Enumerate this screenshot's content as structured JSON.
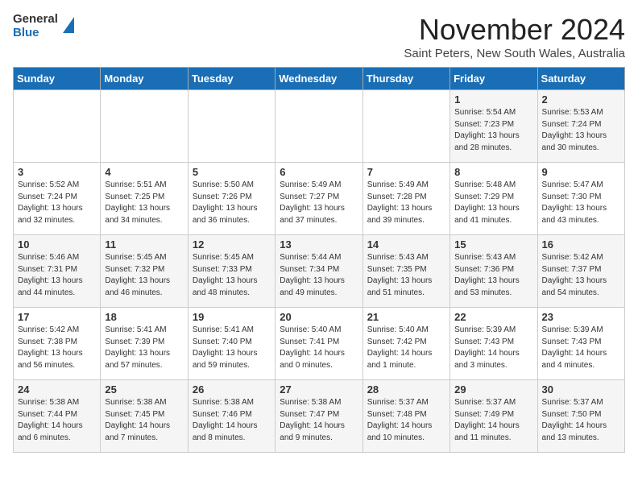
{
  "header": {
    "logo": {
      "general": "General",
      "blue": "Blue"
    },
    "title": "November 2024",
    "location": "Saint Peters, New South Wales, Australia"
  },
  "weekdays": [
    "Sunday",
    "Monday",
    "Tuesday",
    "Wednesday",
    "Thursday",
    "Friday",
    "Saturday"
  ],
  "weeks": [
    [
      {
        "day": "",
        "info": ""
      },
      {
        "day": "",
        "info": ""
      },
      {
        "day": "",
        "info": ""
      },
      {
        "day": "",
        "info": ""
      },
      {
        "day": "",
        "info": ""
      },
      {
        "day": "1",
        "info": "Sunrise: 5:54 AM\nSunset: 7:23 PM\nDaylight: 13 hours and 28 minutes."
      },
      {
        "day": "2",
        "info": "Sunrise: 5:53 AM\nSunset: 7:24 PM\nDaylight: 13 hours and 30 minutes."
      }
    ],
    [
      {
        "day": "3",
        "info": "Sunrise: 5:52 AM\nSunset: 7:24 PM\nDaylight: 13 hours and 32 minutes."
      },
      {
        "day": "4",
        "info": "Sunrise: 5:51 AM\nSunset: 7:25 PM\nDaylight: 13 hours and 34 minutes."
      },
      {
        "day": "5",
        "info": "Sunrise: 5:50 AM\nSunset: 7:26 PM\nDaylight: 13 hours and 36 minutes."
      },
      {
        "day": "6",
        "info": "Sunrise: 5:49 AM\nSunset: 7:27 PM\nDaylight: 13 hours and 37 minutes."
      },
      {
        "day": "7",
        "info": "Sunrise: 5:49 AM\nSunset: 7:28 PM\nDaylight: 13 hours and 39 minutes."
      },
      {
        "day": "8",
        "info": "Sunrise: 5:48 AM\nSunset: 7:29 PM\nDaylight: 13 hours and 41 minutes."
      },
      {
        "day": "9",
        "info": "Sunrise: 5:47 AM\nSunset: 7:30 PM\nDaylight: 13 hours and 43 minutes."
      }
    ],
    [
      {
        "day": "10",
        "info": "Sunrise: 5:46 AM\nSunset: 7:31 PM\nDaylight: 13 hours and 44 minutes."
      },
      {
        "day": "11",
        "info": "Sunrise: 5:45 AM\nSunset: 7:32 PM\nDaylight: 13 hours and 46 minutes."
      },
      {
        "day": "12",
        "info": "Sunrise: 5:45 AM\nSunset: 7:33 PM\nDaylight: 13 hours and 48 minutes."
      },
      {
        "day": "13",
        "info": "Sunrise: 5:44 AM\nSunset: 7:34 PM\nDaylight: 13 hours and 49 minutes."
      },
      {
        "day": "14",
        "info": "Sunrise: 5:43 AM\nSunset: 7:35 PM\nDaylight: 13 hours and 51 minutes."
      },
      {
        "day": "15",
        "info": "Sunrise: 5:43 AM\nSunset: 7:36 PM\nDaylight: 13 hours and 53 minutes."
      },
      {
        "day": "16",
        "info": "Sunrise: 5:42 AM\nSunset: 7:37 PM\nDaylight: 13 hours and 54 minutes."
      }
    ],
    [
      {
        "day": "17",
        "info": "Sunrise: 5:42 AM\nSunset: 7:38 PM\nDaylight: 13 hours and 56 minutes."
      },
      {
        "day": "18",
        "info": "Sunrise: 5:41 AM\nSunset: 7:39 PM\nDaylight: 13 hours and 57 minutes."
      },
      {
        "day": "19",
        "info": "Sunrise: 5:41 AM\nSunset: 7:40 PM\nDaylight: 13 hours and 59 minutes."
      },
      {
        "day": "20",
        "info": "Sunrise: 5:40 AM\nSunset: 7:41 PM\nDaylight: 14 hours and 0 minutes."
      },
      {
        "day": "21",
        "info": "Sunrise: 5:40 AM\nSunset: 7:42 PM\nDaylight: 14 hours and 1 minute."
      },
      {
        "day": "22",
        "info": "Sunrise: 5:39 AM\nSunset: 7:43 PM\nDaylight: 14 hours and 3 minutes."
      },
      {
        "day": "23",
        "info": "Sunrise: 5:39 AM\nSunset: 7:43 PM\nDaylight: 14 hours and 4 minutes."
      }
    ],
    [
      {
        "day": "24",
        "info": "Sunrise: 5:38 AM\nSunset: 7:44 PM\nDaylight: 14 hours and 6 minutes."
      },
      {
        "day": "25",
        "info": "Sunrise: 5:38 AM\nSunset: 7:45 PM\nDaylight: 14 hours and 7 minutes."
      },
      {
        "day": "26",
        "info": "Sunrise: 5:38 AM\nSunset: 7:46 PM\nDaylight: 14 hours and 8 minutes."
      },
      {
        "day": "27",
        "info": "Sunrise: 5:38 AM\nSunset: 7:47 PM\nDaylight: 14 hours and 9 minutes."
      },
      {
        "day": "28",
        "info": "Sunrise: 5:37 AM\nSunset: 7:48 PM\nDaylight: 14 hours and 10 minutes."
      },
      {
        "day": "29",
        "info": "Sunrise: 5:37 AM\nSunset: 7:49 PM\nDaylight: 14 hours and 11 minutes."
      },
      {
        "day": "30",
        "info": "Sunrise: 5:37 AM\nSunset: 7:50 PM\nDaylight: 14 hours and 13 minutes."
      }
    ]
  ]
}
